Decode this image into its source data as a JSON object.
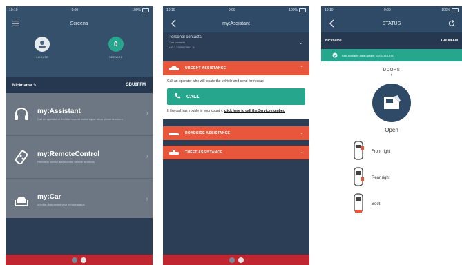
{
  "phone1": {
    "status": {
      "left": "10:10",
      "center": "9:00",
      "right": "100%"
    },
    "title": "Screens",
    "modes": [
      {
        "label": "LOCATE",
        "glyph": "",
        "active": false
      },
      {
        "label": "SERVICE",
        "glyph": "0",
        "active": true
      }
    ],
    "nickname_label": "Nickname",
    "nickname_value": "GDU0FFM",
    "menu": [
      {
        "title": "my:Assistant",
        "sub": "Call an operator or find the nearest workshop or other phone numbers",
        "icon": "headset-icon"
      },
      {
        "title": "my:RemoteControl",
        "sub": "Remotely control and monitor vehicle functions",
        "icon": "remote-icon"
      },
      {
        "title": "my:Car",
        "sub": "Monitor and control your vehicle status",
        "icon": "car-hand-icon"
      }
    ]
  },
  "phone2": {
    "status": {
      "left": "10:10",
      "center": "9:00",
      "right": "100%"
    },
    "title": "my:Assistant",
    "contacts": {
      "title": "Personal contacts",
      "subtitle": "Ciao contacts",
      "number": "+39 1 2345678901"
    },
    "urgent": {
      "header": "URGENT ASSISTANCE",
      "text": "Call an operator who will locate the vehicle and send for rescue.",
      "call_label": "CALL",
      "footer_text": "If the call has trouble in your country,",
      "footer_link": "click here to call the Service number."
    },
    "roadside": {
      "header": "ROADSIDE ASSISTANCE"
    },
    "theft": {
      "header": "THEFT ASSISTANCE"
    }
  },
  "phone3": {
    "status": {
      "left": "10:10",
      "center": "9:00",
      "right": "100%"
    },
    "title": "STATUS",
    "nickname_label": "Nickname",
    "nickname_value": "GDU0FFM",
    "banner": "Last available data update: 15/01/18 13:00",
    "doors_label": "DOORS",
    "open_label": "Open",
    "doors": [
      {
        "name": "Front right"
      },
      {
        "name": "Rear right"
      },
      {
        "name": "Boot"
      }
    ]
  },
  "colors": {
    "navy": "#2c3e55",
    "slate": "#6d7784",
    "orange": "#e8573b",
    "teal": "#27a68e",
    "red": "#c0262f"
  }
}
